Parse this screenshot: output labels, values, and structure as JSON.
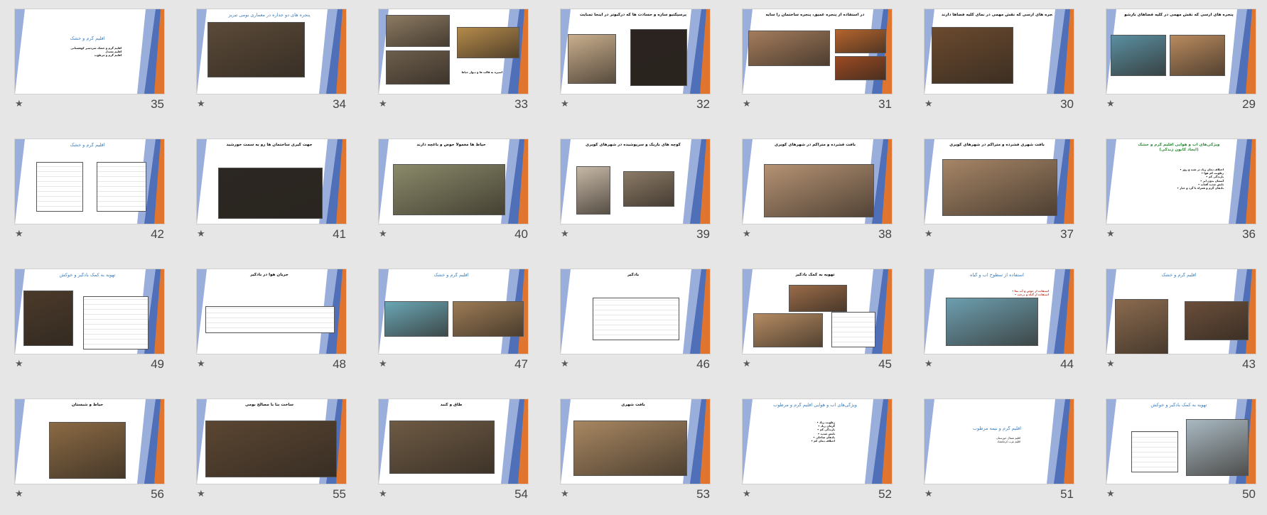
{
  "slides": [
    {
      "number": "35",
      "title": "اقلیم گرم و خشک",
      "lines": [
        "اقلیم گرم و خشک سردسیر کوهستانی",
        "اقلیم معتدل",
        "اقلیم گرم و مرطوب"
      ],
      "star": "★"
    },
    {
      "number": "34",
      "title": "پنجره های دو جداره در معماری بومی تبریز",
      "star": "★"
    },
    {
      "number": "33",
      "title": "",
      "caption": "اسپره به قالب ها و دیوار حیاط",
      "star": "★"
    },
    {
      "number": "32",
      "title": "پرسپکتیو سازه و حسادت ها که درکبوتر در اینجا تمنایت",
      "star": "★"
    },
    {
      "number": "31",
      "title": "در استفاده از پنجره عمیق، پنجره ساختمان را سایه",
      "star": "★"
    },
    {
      "number": "30",
      "title": "پنجره های ارسی که نقش مهمی در نمای کلیه فضاها دارند",
      "star": "★"
    },
    {
      "number": "29",
      "title": "پنجره های ارسی که نقش مهمی در کلیه فضاهای بازشو",
      "star": "★"
    },
    {
      "number": "42",
      "title": "اقلیم گرم و خشک",
      "star": "★"
    },
    {
      "number": "41",
      "title": "جهت گیری ساختمان ها رو به سمت خورشید",
      "star": "★"
    },
    {
      "number": "40",
      "title": "حیاط ها معمولا حوض و باغچه دارند",
      "star": "★"
    },
    {
      "number": "39",
      "title": "کوچه های باریک و سرپوشیده در شهرهای کویری",
      "star": "★"
    },
    {
      "number": "38",
      "title": "بافت فشرده و متراکم در شهرهای کویری",
      "star": "★"
    },
    {
      "number": "37",
      "title": "بافت شهری فشرده و متراکم در شهرهای کویری",
      "star": "★"
    },
    {
      "number": "36",
      "title": "ویژگی‌های آب و هوایی اقلیم گرم و خشک",
      "subtitle": "(ایجاد کانون زندگی)",
      "lines": [
        "اختلاف دمای زیاد در شب و روز",
        "رطوبت کم هوا",
        "بارندگی کم",
        "آسمان بدون ابر",
        "تابش شدید آفتاب",
        "بادهای گرم و همراه با گرد و غبار"
      ],
      "star": "★"
    },
    {
      "number": "49",
      "title": "تهویه به کمک بادگیر و خوکش",
      "star": "★"
    },
    {
      "number": "48",
      "title": "جریان هوا در بادگیر",
      "star": "★"
    },
    {
      "number": "47",
      "title": "اقلیم گرم و خشک",
      "star": "★"
    },
    {
      "number": "46",
      "title": "بادگیر",
      "star": "★"
    },
    {
      "number": "45",
      "title": "تهویه به کمک بادگیر",
      "star": "★"
    },
    {
      "number": "44",
      "title": "استفاده از سطوح آب و گیاه",
      "lines": [
        "استفاده از حوض و آب نما",
        "استفاده از گیاه و درخت"
      ],
      "star": "★"
    },
    {
      "number": "43",
      "title": "اقلیم گرم و خشک",
      "star": "★"
    },
    {
      "number": "56",
      "title": "حیاط و شبستان",
      "star": "★"
    },
    {
      "number": "55",
      "title": "ساخت بنا با مصالح بومی",
      "star": "★"
    },
    {
      "number": "54",
      "title": "طاق و گنبد",
      "star": "★"
    },
    {
      "number": "53",
      "title": "بافت شهری",
      "star": "★"
    },
    {
      "number": "52",
      "title": "ویژگی‌های آب و هوایی اقلیم گرم و مرطوب",
      "lines": [
        "رطوبت زیاد",
        "گرمای زیاد",
        "بارندگی کم",
        "تابش شدید",
        "بادهای ساحلی",
        "اختلاف دمای کم"
      ],
      "star": "★"
    },
    {
      "number": "51",
      "title": "اقلیم گرم و نیمه مرطوب",
      "lines": [
        "اقلیم شمال خوزستان",
        "اقلیم غرب کرمانشاه"
      ],
      "star": "★"
    },
    {
      "number": "50",
      "title": "تهویه به کمک بادگیر و خوکش",
      "star": "★"
    }
  ],
  "colors": {
    "deco_blue": "#4f6fb8",
    "deco_light": "#9aaedb",
    "deco_orange": "#e0752f",
    "title_blue": "#3a7fc4",
    "title_green": "#2e8b3a"
  }
}
